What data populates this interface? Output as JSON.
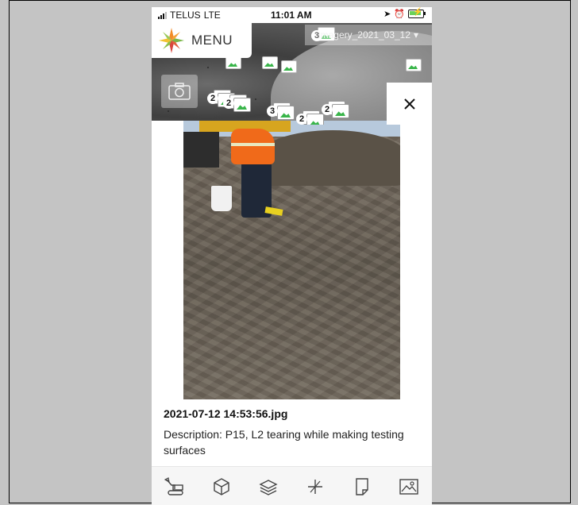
{
  "status_bar": {
    "carrier": "TELUS",
    "network": "LTE",
    "time": "11:01 AM"
  },
  "map": {
    "menu_label": "MENU",
    "imagery_layer": "imagery_2021_03_12",
    "cluster_counts": [
      "3",
      "2",
      "2",
      "3",
      "2",
      "2"
    ]
  },
  "photo_detail": {
    "filename": "2021-07-12 14:53:56.jpg",
    "description": "Description: P15, L2 tearing while making testing surfaces"
  },
  "toolbar": {
    "tools": [
      "excavator-icon",
      "box-icon",
      "layers-icon",
      "measure-icon",
      "document-icon",
      "image-icon"
    ]
  },
  "colors": {
    "accent_green": "#39b54a",
    "logo_orange": "#f28c28",
    "logo_green": "#7ab648",
    "logo_red": "#d9453c"
  }
}
